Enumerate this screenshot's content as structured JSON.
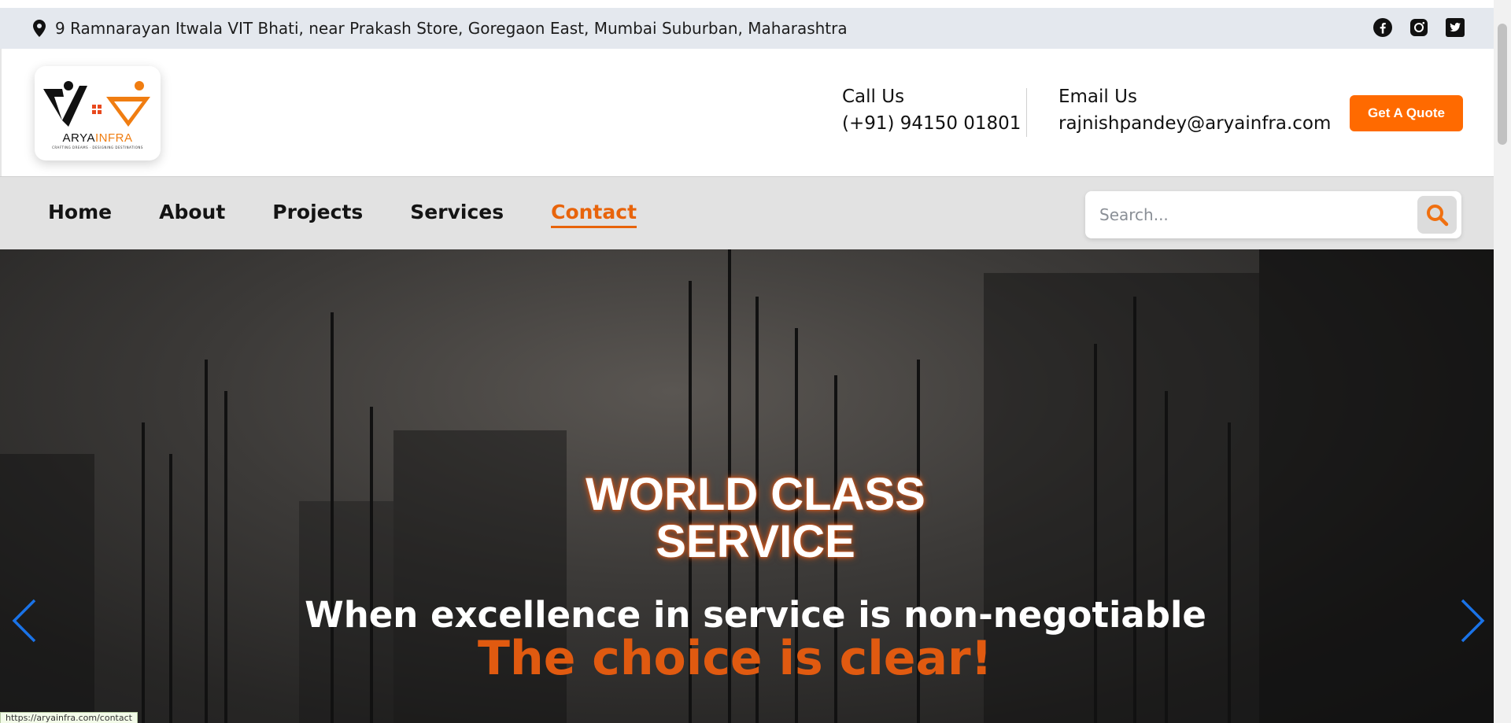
{
  "topbar": {
    "address": "9 Ramnarayan Itwala VIT Bhati, near Prakash Store, Goregaon East, Mumbai Suburban, Maharashtra",
    "socials": [
      "facebook-icon",
      "instagram-icon",
      "twitter-icon"
    ]
  },
  "header": {
    "logo": {
      "word_a": "ARYA",
      "word_b": "INFRA",
      "tagline": "CRAFTING DREAMS · DESIGNING DESTINATIONS"
    },
    "call": {
      "label": "Call Us",
      "value": "(+91) 94150 01801"
    },
    "email": {
      "label": "Email Us",
      "value": "rajnishpandey@aryainfra.com"
    },
    "quote_button": "Get A Quote"
  },
  "nav": {
    "items": [
      {
        "label": "Home",
        "active": false
      },
      {
        "label": "About",
        "active": false
      },
      {
        "label": "Projects",
        "active": false
      },
      {
        "label": "Services",
        "active": false
      },
      {
        "label": "Contact",
        "active": true
      }
    ],
    "search_placeholder": "Search..."
  },
  "hero": {
    "title_line1": "WORLD CLASS",
    "title_line2": "SERVICE",
    "subtitle": "When excellence in service is non-negotiable",
    "tagline": "The choice is clear!"
  },
  "status_url": "https://aryainfra.com/contact",
  "colors": {
    "accent": "#ff6a00",
    "nav_active": "#e8640b",
    "topbar_bg": "#e4e8ee",
    "nav_bg": "#e2e2e2",
    "arrow": "#1a73e8"
  }
}
